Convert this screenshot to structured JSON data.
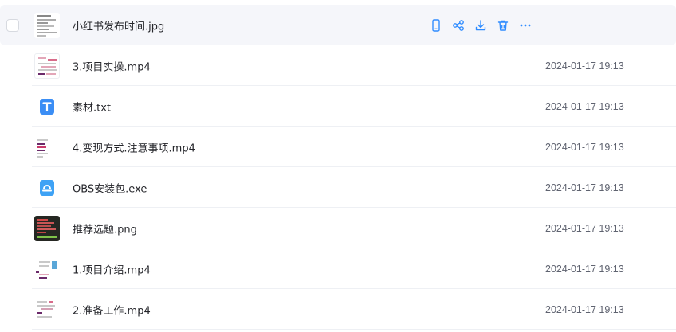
{
  "colors": {
    "accent": "#2f8cff",
    "hover_row_bg": "#f5f6fa",
    "date_text": "#5f6370",
    "txt_icon": "#3b8ef5",
    "exe_icon": "#3ea2f5"
  },
  "hover_actions": [
    "phone-icon",
    "share-icon",
    "download-icon",
    "trash-icon",
    "more-icon"
  ],
  "files": [
    {
      "name": "小红书发布时间.jpg",
      "date": "",
      "icon": "image-thumbnail"
    },
    {
      "name": "3.项目实操.mp4",
      "date": "2024-01-17 19:13",
      "icon": "video-thumbnail"
    },
    {
      "name": "素材.txt",
      "date": "2024-01-17 19:13",
      "icon": "txt-file-icon"
    },
    {
      "name": "4.变现方式.注意事项.mp4",
      "date": "2024-01-17 19:13",
      "icon": "video-thumbnail"
    },
    {
      "name": "OBS安装包.exe",
      "date": "2024-01-17 19:13",
      "icon": "exe-file-icon"
    },
    {
      "name": "推荐选题.png",
      "date": "2024-01-17 19:13",
      "icon": "image-thumbnail"
    },
    {
      "name": "1.项目介绍.mp4",
      "date": "2024-01-17 19:13",
      "icon": "video-thumbnail"
    },
    {
      "name": "2.准备工作.mp4",
      "date": "2024-01-17 19:13",
      "icon": "video-thumbnail"
    }
  ]
}
